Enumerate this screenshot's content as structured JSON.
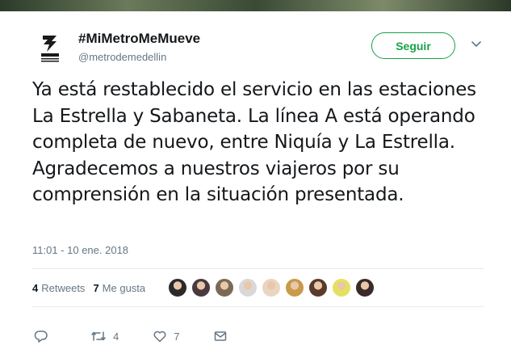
{
  "tweet": {
    "display_name": "#MiMetroMeMueve",
    "handle": "@metrodemedellin",
    "follow_label": "Seguir",
    "text": "Ya está restablecido el servicio en las estaciones La Estrella y Sabaneta. La línea A está operando completa de nuevo, entre Niquía y La Estrella. Agradecemos a nuestros viajeros por su comprensión en la situación presentada.",
    "timestamp": "11:01 - 10 ene. 2018",
    "retweets_count": "4",
    "retweets_label": "Retweets",
    "likes_count": "7",
    "likes_label": "Me gusta"
  },
  "actions": {
    "reply_icon": "reply-icon",
    "retweet_icon": "retweet-icon",
    "retweet_count": "4",
    "like_icon": "heart-icon",
    "like_count": "7",
    "dm_icon": "envelope-icon"
  },
  "colors": {
    "follow_accent": "#17a34a",
    "secondary_text": "#657786",
    "divider": "#e6ecf0"
  },
  "likers": [
    {
      "name": "liker-avatar-1",
      "color": "#2a2a2a"
    },
    {
      "name": "liker-avatar-2",
      "color": "#4a3a40"
    },
    {
      "name": "liker-avatar-3",
      "color": "#7a6a55"
    },
    {
      "name": "liker-avatar-4",
      "color": "#d8d8d8"
    },
    {
      "name": "liker-avatar-5",
      "color": "#e9d6c2"
    },
    {
      "name": "liker-avatar-6",
      "color": "#c89a4a"
    },
    {
      "name": "liker-avatar-7",
      "color": "#5a3a2a"
    },
    {
      "name": "liker-avatar-8",
      "color": "#e6e060"
    },
    {
      "name": "liker-avatar-9",
      "color": "#3a2a2a"
    }
  ]
}
